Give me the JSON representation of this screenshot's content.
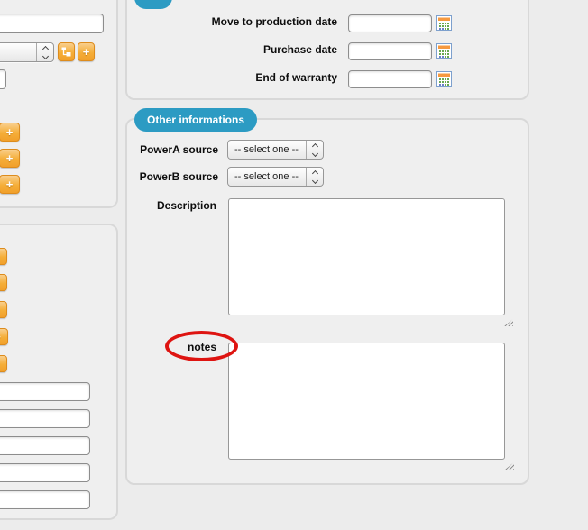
{
  "colors": {
    "accent_blue": "#2c9bc3",
    "button_orange": "#f5ae38",
    "annotation_red": "#de1411",
    "page_bg": "#ececec"
  },
  "left_panel_top": {
    "name_input": {
      "value": ""
    },
    "type_select": {
      "value": ""
    },
    "tree_button": {
      "icon": "tree-hierarchy-icon"
    },
    "add_button_label": "+",
    "partial_input": {
      "value": ""
    },
    "row_add_buttons": [
      {
        "label": "+"
      },
      {
        "label": "+"
      },
      {
        "label": "+"
      }
    ]
  },
  "left_panel_bottom": {
    "row_buttons": [
      {
        "label": "+"
      },
      {
        "label": "+"
      },
      {
        "label": "+"
      },
      {
        "label": "+"
      },
      {
        "label": "+"
      }
    ],
    "inputs": [
      {
        "value": ""
      },
      {
        "value": ""
      },
      {
        "value": ""
      },
      {
        "value": ""
      },
      {
        "value": ""
      }
    ]
  },
  "dates_panel": {
    "rows": [
      {
        "label": "Move to production date",
        "value": ""
      },
      {
        "label": "Purchase date",
        "value": ""
      },
      {
        "label": "End of warranty",
        "value": ""
      }
    ],
    "calendar_icon": "calendar-picker-icon"
  },
  "other_panel": {
    "tab_label": "Other informations",
    "power_rows": [
      {
        "label": "PowerA source",
        "value": "-- select one --"
      },
      {
        "label": "PowerB source",
        "value": "-- select one --"
      }
    ],
    "description": {
      "label": "Description",
      "value": ""
    },
    "notes": {
      "label": "notes",
      "value": ""
    }
  }
}
